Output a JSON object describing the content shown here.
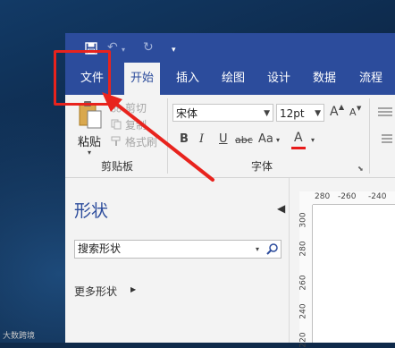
{
  "qat": {
    "save_icon": "save-icon",
    "undo_icon": "undo-icon",
    "redo_icon": "redo-icon",
    "customize_icon": "customize-qat-icon"
  },
  "tabs": [
    {
      "label": "文件"
    },
    {
      "label": "开始"
    },
    {
      "label": "插入"
    },
    {
      "label": "绘图"
    },
    {
      "label": "设计"
    },
    {
      "label": "数据"
    },
    {
      "label": "流程"
    }
  ],
  "clipboard": {
    "paste_label": "粘贴",
    "cut_label": "剪切",
    "copy_label": "复制",
    "format_painter_label": "格式刷",
    "group_label": "剪贴板"
  },
  "font": {
    "font_name": "宋体",
    "font_size": "12pt",
    "grow_label": "A",
    "shrink_label": "A",
    "bold_label": "B",
    "italic_label": "I",
    "underline_label": "U",
    "strike_label": "abc",
    "case_label": "Aa",
    "color_label": "A",
    "group_label": "字体"
  },
  "shapes": {
    "title": "形状",
    "search_value": "搜索形状",
    "more_label": "更多形状"
  },
  "ruler": {
    "top_ticks": [
      "280",
      "-260",
      "-240"
    ],
    "left_ticks": [
      "300",
      "280",
      "260",
      "240",
      "220"
    ]
  },
  "watermark": "大数跨境",
  "colors": {
    "accent": "#2c4c9c",
    "annotation": "#e8231d",
    "font_color": "#e81b1b"
  }
}
